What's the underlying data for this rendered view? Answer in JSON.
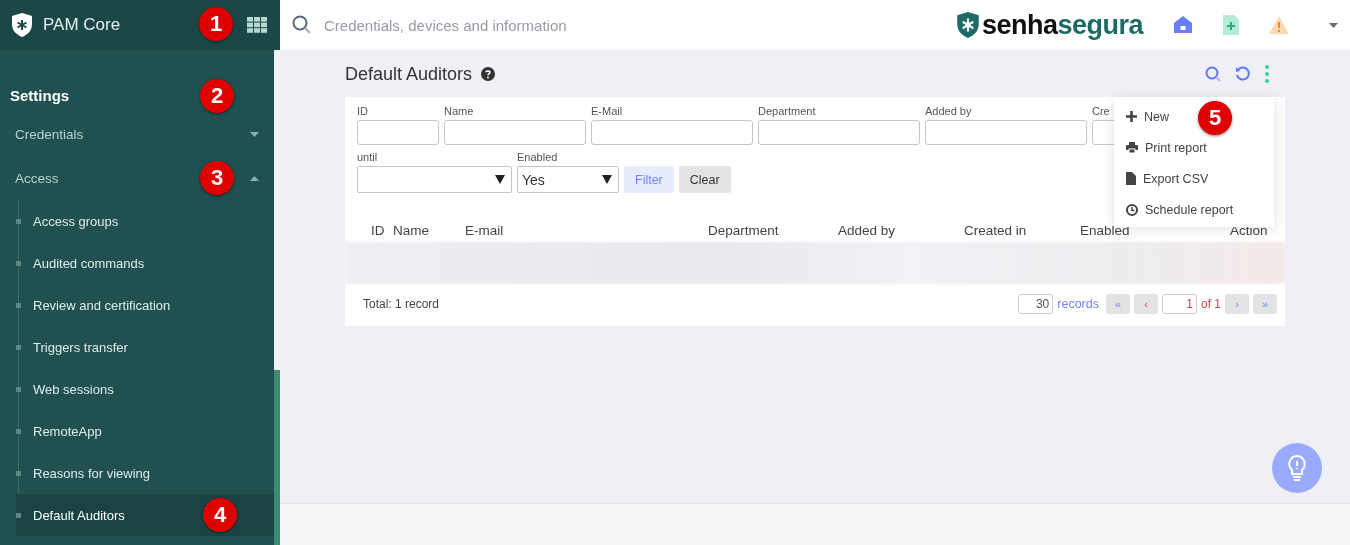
{
  "app": {
    "name": "PAM Core",
    "marker": "1"
  },
  "search": {
    "placeholder": "Credentials, devices and information"
  },
  "logo_text": [
    "senha",
    "segura"
  ],
  "sidebar": {
    "heading": "Settings",
    "heading_marker": "2",
    "sections": [
      {
        "label": "Credentials",
        "expanded": false
      },
      {
        "label": "Access",
        "expanded": true,
        "marker": "3",
        "children": [
          {
            "label": "Access groups",
            "selected": false
          },
          {
            "label": "Audited commands",
            "selected": false
          },
          {
            "label": "Review and certification",
            "selected": false
          },
          {
            "label": "Triggers transfer",
            "selected": false
          },
          {
            "label": "Web sessions",
            "selected": false
          },
          {
            "label": "RemoteApp",
            "selected": false
          },
          {
            "label": "Reasons for viewing",
            "selected": false
          },
          {
            "label": "Default Auditors",
            "selected": true,
            "marker": "4"
          }
        ]
      }
    ]
  },
  "page": {
    "title": "Default Auditors"
  },
  "filters": {
    "row_1": [
      {
        "label": "ID"
      },
      {
        "label": "Name"
      },
      {
        "label": "E-Mail"
      },
      {
        "label": "Department"
      },
      {
        "label": "Added by"
      },
      {
        "label": "Cre"
      }
    ],
    "row_2": [
      {
        "label": "until"
      },
      {
        "label": "Enabled",
        "value": "Yes"
      }
    ],
    "buttons": [
      "Filter",
      "Clear"
    ]
  },
  "table": {
    "columns": [
      "ID",
      "Name",
      "E-mail",
      "Department",
      "Added by",
      "Created in",
      "Enabled",
      "Action"
    ],
    "rows": [
      {
        "kind": "blurred"
      }
    ],
    "total": "Total: 1 record"
  },
  "pagination": {
    "page_size": "30",
    "page_size_label": "records",
    "first": "«",
    "prev": "‹",
    "page": "1",
    "of": "of 1",
    "next": "›",
    "last": "»"
  },
  "menu": {
    "items": [
      {
        "label": "New",
        "marker": "5"
      },
      {
        "label": "Print report"
      },
      {
        "label": "Export CSV"
      },
      {
        "label": "Schedule report"
      }
    ]
  }
}
